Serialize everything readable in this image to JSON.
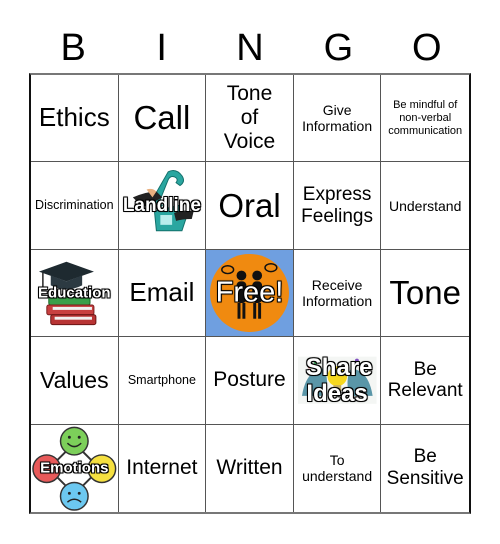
{
  "header": {
    "letters": [
      "B",
      "I",
      "N",
      "G",
      "O"
    ]
  },
  "board": {
    "rows": [
      [
        {
          "text": "Ethics"
        },
        {
          "text": "Call"
        },
        {
          "text": "Tone of Voice"
        },
        {
          "text": "Give Information"
        },
        {
          "text": "Be mindful of non-verbal communication"
        }
      ],
      [
        {
          "text": "Discrimination"
        },
        {
          "text": "Landline",
          "icon": "telephone-icon"
        },
        {
          "text": "Oral"
        },
        {
          "text": "Express Feelings"
        },
        {
          "text": "Understand"
        }
      ],
      [
        {
          "text": "Education",
          "icon": "graduation-books-icon"
        },
        {
          "text": "Email"
        },
        {
          "text": "Free!",
          "icon": "people-talking-icon",
          "free": true
        },
        {
          "text": "Receive Information"
        },
        {
          "text": "Tone"
        }
      ],
      [
        {
          "text": "Values"
        },
        {
          "text": "Smartphone"
        },
        {
          "text": "Posture"
        },
        {
          "text": "Share Ideas",
          "icon": "lightbulb-heads-icon"
        },
        {
          "text": "Be Relevant"
        }
      ],
      [
        {
          "text": "Emotions",
          "icon": "emotion-faces-icon"
        },
        {
          "text": "Internet"
        },
        {
          "text": "Written"
        },
        {
          "text": "To understand"
        },
        {
          "text": "Be Sensitive"
        }
      ]
    ]
  },
  "colors": {
    "free_background": "#6f9fe0",
    "free_circle": "#f08a10",
    "phone_teal": "#2aa6a0",
    "happy_green": "#7ccf5a",
    "sad_blue": "#6cc8f0",
    "neutral_yellow": "#f5e040",
    "angry_red": "#e85a5a"
  }
}
